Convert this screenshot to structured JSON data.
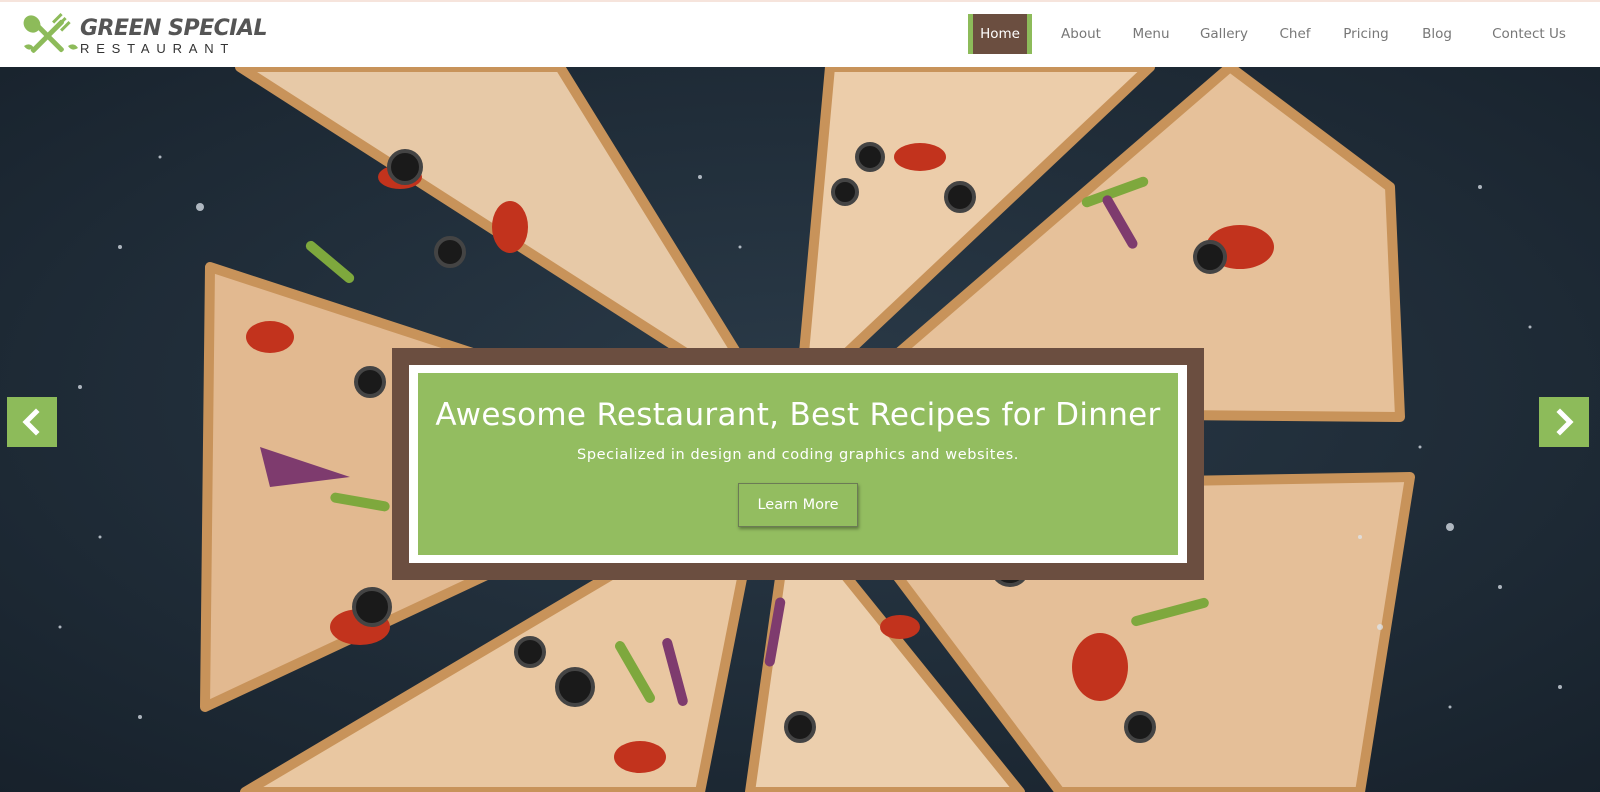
{
  "brand": {
    "title": "GREEN SPECIAL",
    "subtitle": "RESTAURANT",
    "icon": "fork-spoon-cross-icon"
  },
  "nav": {
    "items": [
      {
        "label": "Home",
        "active": true
      },
      {
        "label": "About",
        "active": false
      },
      {
        "label": "Menu",
        "active": false
      },
      {
        "label": "Gallery",
        "active": false
      },
      {
        "label": "Chef",
        "active": false
      },
      {
        "label": "Pricing",
        "active": false
      },
      {
        "label": "Blog",
        "active": false
      },
      {
        "label": "Contect Us",
        "active": false
      }
    ]
  },
  "hero": {
    "background": "pizza-slices-photo",
    "title": "Awesome Restaurant, Best Recipes for Dinner",
    "subtitle": "Specialized in design and coding graphics and websites.",
    "button_label": "Learn More",
    "prev_icon": "chevron-left-icon",
    "next_icon": "chevron-right-icon"
  },
  "colors": {
    "accent_green": "#93bd60",
    "accent_brown": "#6b4e40",
    "header_bg": "#ffffff",
    "nav_text": "#777777"
  }
}
